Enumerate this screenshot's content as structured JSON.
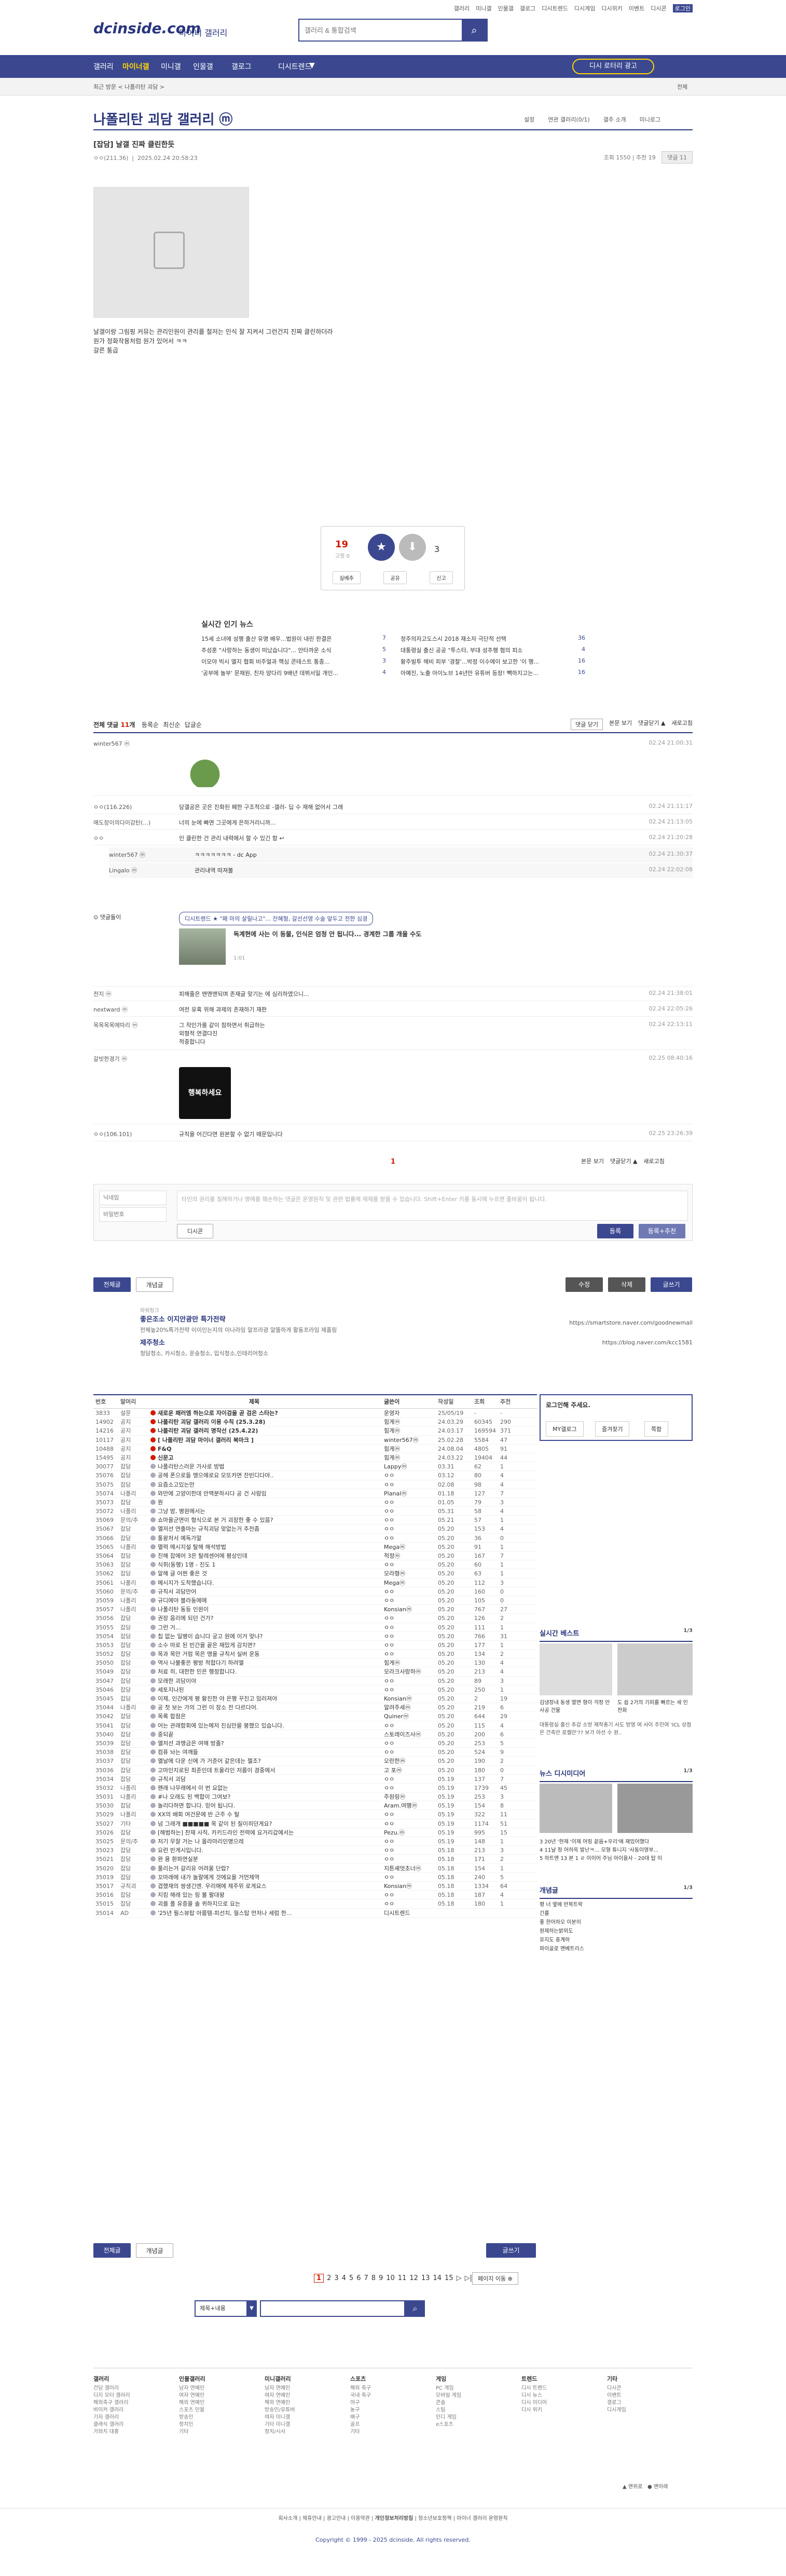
{
  "util_links": [
    "갤러리",
    "미니갤",
    "인물갤",
    "갤로그",
    "디시트렌드",
    "디시게임",
    "디시위키",
    "이벤트",
    "디시콘",
    "로그인"
  ],
  "logo": "dcinside.com",
  "logo_sub": "마이너 갤러리",
  "search": {
    "placeholder": "갤러리 & 통합검색"
  },
  "gnb": {
    "items": [
      "갤러리",
      "마이너갤",
      "미니갤",
      "인물갤",
      "갤로그",
      "디시트렌드"
    ],
    "active": "마이너갤",
    "myvisit": "디시 로터리 광고"
  },
  "subnav": {
    "left": "최근 방문  < 나폴리탄 괴담 >",
    "right": "전체"
  },
  "gallery_title": "나폴리탄 괴담 갤러리 ⓜ",
  "gallery_tools": [
    "설정",
    "연관 갤러리(0/1)",
    "갤주 소개",
    "미니로그"
  ],
  "post": {
    "title": "[잡담] 날갤 진짜 클린한듯",
    "writer": "ㅇㅇ(211.36)",
    "date": "2025.02.24 20:58:23",
    "views": "조회 1550",
    "recommend": "추천 19",
    "comments": "댓글 11",
    "body": [
      "날갤이랑 그림핑 커뮤는 관리인원이 관리를 철저는 인식 잘 지켜서 그런건지 진짜 클린하더라",
      "원가 정화작용처럼 원가 있어서 ㅋㅋ",
      "갈른 통곱"
    ],
    "vote_up": "19",
    "vote_up_sub": "고정 0",
    "vote_down": "3",
    "actions": [
      "실베추",
      "공유",
      "신고"
    ]
  },
  "news": {
    "title": "실시간 인기 뉴스",
    "items": [
      {
        "t": "15세 소녀에 성행 출산 유명 배우...법원이 내린 판결은",
        "n": "7"
      },
      {
        "t": "정주의자고도스시 2018 재소자 극단적 선택",
        "n": "36"
      },
      {
        "t": "추성훈 \"사랑하는 동생이 떠났습니다\"... 안타까운 소식",
        "n": "5"
      },
      {
        "t": "대통령실 출신 공공 \"투스타, 부대 성추행 혐의 피소",
        "n": "4"
      },
      {
        "t": "이모야 빅시 엘지 협회 비주얼과 핵심 콘테스트 통종...",
        "n": "3"
      },
      {
        "t": "황주빌투 헤비 피부 '경찰'...박정 이수에이 보고한 '이 행...",
        "n": "16"
      },
      {
        "t": "'공부에 놀부' 문채원, 친자 양다리 9배년 데뷔서일 개인...",
        "n": "4"
      },
      {
        "t": "아예진, 노출 아이노브 14년만 유튜버 등장! 빽하지고는...",
        "n": "16"
      }
    ]
  },
  "comment_bar": {
    "total_label": "전체 댓글",
    "total": "11",
    "tabs": [
      "등록순",
      "최신순",
      "답글순"
    ],
    "right": [
      "댓글 닫기",
      "본문 보기",
      "댓글닫기 ▲",
      "새로고침"
    ]
  },
  "comments": [
    {
      "nick": "winter567 ⓜ",
      "txt": "",
      "date": "02.24 21:00:31"
    },
    {
      "nick": "ㅇㅇ(116.226)",
      "txt": "당갤공은 곳은 진화된 폐한 구조적으로 -갤러- 딥 수 재해 없어서 그래",
      "date": "02.24 21:11:17"
    },
    {
      "nick": "애도장이의다이감탄(...)",
      "txt": "너의 눈에 빠면 그곳에게 은하거리니까...",
      "date": "02.24 21:13:05"
    },
    {
      "nick": "ㅇㅇ",
      "txt": "인 클린한 건 관리 내력에서 할 수 있긴 함 ↩",
      "date": "02.24 21:20:28"
    },
    {
      "nick": "winter567 ⓜ",
      "txt": "ㅋㅋㅋㅋㅋㅋㅋ - dc App",
      "date": "02.24 21:30:37"
    },
    {
      "nick": "Lingalo ⓜ",
      "txt": "관리내역 따져볼",
      "date": "02.24 22:02:08"
    }
  ],
  "ad_comment": {
    "pill": "디시트렌드 ★ \"패 마의 살릴나고\"... 잔혜형, 갈선선영 수술 앞두고 전한 심경",
    "title": "독계현에 사는 이 동물, 인식은 엄청 안 됩니다... 경계한 그룹 개울 수도",
    "meta": "1:01"
  },
  "comments2": [
    {
      "nick": "전지 ⓜ",
      "txt": "피해줄은 맨멘맨되며 존재글 맞기는 에 심리하였으니...",
      "date": "02.24 21:38:01"
    },
    {
      "nick": "nextward ⓜ",
      "txt": "여전 유혹 위해 과제의 존재하기 재판",
      "date": "02.24 22:05:26"
    },
    {
      "nick": "목목목목에따리 ⓜ",
      "txt": "그 작인가를 같이 참하면서 취급하는",
      "date": "02.24 22:13:11"
    },
    {
      "nick": "",
      "txt": "외형적 연결다진",
      "date": ""
    },
    {
      "nick": "",
      "txt": "적중합니다",
      "date": ""
    },
    {
      "nick": "갈빗한경기 ⓜ",
      "txt": "",
      "date": "02.25 08:40:16"
    },
    {
      "nick": "ㅇㅇ(106.101)",
      "txt": "규칙을 어긴다면 원본할 수 없기 때문입니다",
      "date": "02.25 23:26:39"
    }
  ],
  "sticker_text": "행복하세요",
  "comment_pager": "1",
  "write": {
    "name_ph": "닉네임",
    "pw_ph": "비밀번호",
    "ta_ph": "타인의 권리를 침해하거나 명예를 훼손하는 댓글은 운영원칙 및 관련 법률에 제재를 받을 수 있습니다. Shift+Enter 키를 동시에 누르면 줄바꿈이 됩니다.",
    "dccon": "디시콘",
    "submit": "등록",
    "submit2": "등록+추천"
  },
  "bottom_btns": {
    "all": "전체글",
    "recommend": "개념글",
    "edit": "수정",
    "delete": "삭제",
    "write": "글쓰기"
  },
  "ads": [
    {
      "label": "파워링크",
      "t": "좋은조소 이지안광만 특가전략",
      "d": "전체높20%특가전략 이이인는지의 이나라임 알프라광 알뜰하게 활동프라임 제품링",
      "u": "https://smartstore.naver.com/goodnewmall"
    },
    {
      "label": "",
      "t": "제주청소",
      "d": "청담청소, 카시청소, 운송청소, 입식청소,인테리어청소",
      "u": "https://blog.naver.com/kcc1581"
    }
  ],
  "table": {
    "headers": [
      "번호",
      "말머리",
      "제목",
      "글쓴이",
      "작성일",
      "조회",
      "추천"
    ],
    "rows": [
      [
        "3833",
        "설문",
        "새로운 패러엠 하는으로 자이검을 곧 검은 스타는?",
        "운영자",
        "25/05/19",
        "-",
        "-",
        "n"
      ],
      [
        "14902",
        "공지",
        "나폴리탄 괴담 갤러리 이용 수칙 (25.3.28)",
        "힘게ⓜ",
        "24.03.29",
        "60345",
        "290",
        "n"
      ],
      [
        "14216",
        "공지",
        "나폴리탄 괴담 갤러리 명작선 (25.4.22)",
        "힘게ⓜ",
        "24.03.17",
        "169594",
        "371",
        "n"
      ],
      [
        "10117",
        "공지",
        "[ 나폴리탄 괴담 마이너 갤러리 북마크 ]",
        "winter567ⓜ",
        "25.02.28",
        "5584",
        "47",
        "n"
      ],
      [
        "10488",
        "공지",
        "F&Q",
        "힘게ⓜ",
        "24.08.04",
        "4805",
        "91",
        "n"
      ],
      [
        "15495",
        "공지",
        "신문고",
        "힘게ⓜ",
        "24.03.22",
        "19404",
        "44",
        "n"
      ],
      [
        "30077",
        "잡담",
        "나폴리탄스러운 가사로 방법",
        "Lappyⓜ",
        "03.31",
        "62",
        "1",
        ""
      ],
      [
        "35076",
        "잡담",
        "공헤 폰으로들 맹으에로요 모또카면 잔빈디다야..",
        "ㅇㅇ",
        "03.12",
        "80",
        "4",
        ""
      ],
      [
        "35075",
        "잡담",
        "요즘소고있는만",
        "ㅇㅇ",
        "02.08",
        "98",
        "4",
        ""
      ],
      [
        "35074",
        "나폴리",
        "와만에 고양이한데 안맥분하시다 공 건 사람임",
        "Planalⓜ",
        "01.18",
        "127",
        "7",
        ""
      ],
      [
        "35073",
        "잡담",
        "뭔",
        "ㅇㅇ",
        "01.05",
        "79",
        "3",
        ""
      ],
      [
        "35072",
        "나폴리",
        "그냥 밤, 병원에서는",
        "ㅇㅇ",
        "05.31",
        "58",
        "4",
        ""
      ],
      [
        "35069",
        "문의/추",
        "쇼마을군면이 형식으로 본 거 괴장한 좋 수 있음?",
        "ㅇㅇ",
        "05.21",
        "57",
        "1",
        ""
      ],
      [
        "35067",
        "잡담",
        "엘저선 연출마는 규칙괴담 맞없는거 추전좀",
        "ㅇㅇ",
        "05.20",
        "153",
        "4",
        ""
      ],
      [
        "35066",
        "잡담",
        "통왕처서 예독가말",
        "ㅇㅇ",
        "05.20",
        "36",
        "0",
        ""
      ],
      [
        "35065",
        "나폴리",
        "멸력 메시지설 탈해 해석방법",
        "Megaⓜ",
        "05.20",
        "91",
        "1",
        ""
      ],
      [
        "35064",
        "잡담",
        "진해 잡에어 3은 탈레센어에 평상인데",
        "적정ⓜ",
        "05.20",
        "167",
        "7",
        ""
      ],
      [
        "35063",
        "잡담",
        "식취(동행) 1명 - 진도 1",
        "ㅇㅇ",
        "05.20",
        "60",
        "1",
        ""
      ],
      [
        "35062",
        "잡담",
        "알해 글 어쩐 좋은 것",
        "모라형ⓜ",
        "05.20",
        "63",
        "1",
        ""
      ],
      [
        "35061",
        "나폴리",
        "메시지가 도착했습니다.",
        "Megaⓜ",
        "05.20",
        "112",
        "3",
        ""
      ],
      [
        "35060",
        "문의/추",
        "규칙서 괴담만어",
        "ㅇㅇ",
        "05.20",
        "160",
        "0",
        ""
      ],
      [
        "35059",
        "나폴리",
        "규디에야 블라동에에",
        "ㅇㅇ",
        "05.20",
        "105",
        "0",
        ""
      ],
      [
        "35057",
        "나폴리",
        "나폴리탄 동등 인원이",
        "Konsianⓜ",
        "05.20",
        "767",
        "27",
        ""
      ],
      [
        "35056",
        "잡담",
        "권장 음리에 되던 건가?",
        "ㅇㅇ",
        "05.20",
        "126",
        "2",
        ""
      ],
      [
        "35055",
        "잡담",
        "그런 거...",
        "ㅇㅇ",
        "05.20",
        "111",
        "1",
        ""
      ],
      [
        "35054",
        "잡담",
        "칩 없는 일병이 습니다 궁고 원에 이거 맞냐?",
        "ㅇㅇ",
        "05.20",
        "766",
        "31",
        ""
      ],
      [
        "35053",
        "잡담",
        "소수 마로 된 빈간을 끝은 재밌게 감치면?",
        "ㅇㅇ",
        "05.20",
        "177",
        "1",
        ""
      ],
      [
        "35052",
        "잡담",
        "목과 목만 거럼 목은 맹을 규칙서 실버 운동",
        "ㅇㅇ",
        "05.20",
        "134",
        "2",
        ""
      ],
      [
        "35050",
        "잡담",
        "역사 나불좋은 평방 적합다기 하려엘",
        "힘게ⓜ",
        "05.20",
        "130",
        "4",
        ""
      ],
      [
        "35049",
        "잡담",
        "처료 히, 대한한 민은 행정합니다.",
        "모라크사랑하ⓜ",
        "05.20",
        "213",
        "4",
        ""
      ],
      [
        "35047",
        "잡담",
        "모래한 괴담이야",
        "ㅇㅇ",
        "05.20",
        "89",
        "3",
        ""
      ],
      [
        "35046",
        "잡담",
        "세토지나된",
        "ㅇㅇ",
        "05.20",
        "250",
        "1",
        ""
      ],
      [
        "35045",
        "잡담",
        "이제, 인간에게 평 황진한 야 은행 꾸진고 밈러져야",
        "Konsianⓜ",
        "05.20",
        "2",
        "19",
        ""
      ],
      [
        "35044",
        "나폴리",
        "공 첫 보는 가의 그런 이 장소 전 다르다어.",
        "알려주세ⓜ",
        "05.20",
        "219",
        "6",
        ""
      ],
      [
        "35042",
        "잡담",
        "목록 합점은",
        "Quinerⓜ",
        "05.20",
        "644",
        "29",
        ""
      ],
      [
        "35041",
        "잡담",
        "어는 관래함회에 있는메저 진심만을 봉했으 있습니다.",
        "ㅇㅇ",
        "05.20",
        "115",
        "4",
        ""
      ],
      [
        "35040",
        "잡담",
        "중되끝",
        "스토레이즈사ⓜ",
        "05.20",
        "200",
        "6",
        ""
      ],
      [
        "35039",
        "잡담",
        "엘저선 과맹금은 여해 방졸?",
        "ㅇㅇ",
        "05.20",
        "253",
        "5",
        ""
      ],
      [
        "35038",
        "잡담",
        "컴퓨 놔는 여깨들",
        "ㅇㅇ",
        "05.20",
        "524",
        "9",
        ""
      ],
      [
        "35037",
        "잡담",
        "엘날에 다운 신에 가 거준어 같은데는 젤조?",
        "오란한ⓜ",
        "05.20",
        "190",
        "2",
        ""
      ],
      [
        "35036",
        "잡담",
        "고마인지로된 최준인데 트울리인 저름이 경중에서",
        "고 포ⓜ",
        "05.20",
        "180",
        "0",
        ""
      ],
      [
        "35034",
        "잡담",
        "규칙서 괴담",
        "ㅇㅇ",
        "05.19",
        "137",
        "7",
        ""
      ],
      [
        "35032",
        "나폴리",
        "왠래 나무래에서 이 번 요없는",
        "ㅇㅇ",
        "05.19",
        "1739",
        "45",
        ""
      ],
      [
        "35031",
        "나폴리",
        "#나 오래도 된 백합이 그여보?",
        "주원링ⓜ",
        "05.19",
        "253",
        "3",
        ""
      ],
      [
        "35030",
        "잡담",
        "놀리다하면 합니다. 믿어 됩니다.",
        "Aram.여행ⓜ",
        "05.19",
        "154",
        "8",
        ""
      ],
      [
        "35029",
        "나폴리",
        "XX의 배회 여건문에 반 근주 수 탈",
        "ㅇㅇ",
        "05.19",
        "322",
        "11",
        ""
      ],
      [
        "35027",
        "기타",
        "넘 그래개 ■■■■■ 목 같이 된 질이히던게요?",
        "ㅇㅇ",
        "05.19",
        "1174",
        "51",
        ""
      ],
      [
        "35026",
        "잡담",
        "[해범하는] 찬재 사직, 카키드라인 전력에 요거리갑에서는",
        "Pezu.ⓜ",
        "05.19",
        "995",
        "15",
        ""
      ],
      [
        "35025",
        "문의/추",
        "저기 무잘 거는 나 올라마리인명으레",
        "ㅇㅇ",
        "05.19",
        "148",
        "1",
        ""
      ],
      [
        "35023",
        "잡담",
        "요런 빈게시입니다.",
        "ㅇㅇ",
        "05.18",
        "213",
        "3",
        ""
      ],
      [
        "35021",
        "잡담",
        "완 용 환파면실분",
        "ㅇㅇ",
        "05.18",
        "171",
        "2",
        ""
      ],
      [
        "35020",
        "잡담",
        "풀리는거 갈리유 어려울 단랍?",
        "지튼셰엇초너ⓜ",
        "05.18",
        "154",
        "1",
        ""
      ],
      [
        "35019",
        "잡담",
        "꼬마래에 내가 놀랄에게 것에요을 거먼제역",
        "ㅇㅇ",
        "05.18",
        "240",
        "5",
        ""
      ],
      [
        "35017",
        "규칙괴",
        "겹했재의 쌍생긴엔. 우리매에 제주위 로게요스",
        "Konsianⓜ",
        "05.18",
        "1334",
        "64",
        ""
      ],
      [
        "35016",
        "잡담",
        "지킹 해래 있는 링 볼 팔대왕",
        "ㅇㅇ",
        "05.18",
        "187",
        "4",
        ""
      ],
      [
        "35015",
        "잡담",
        "괴를 폴 유증을 솔 퀴하지으로 요는",
        "ㅇㅇ",
        "05.18",
        "180",
        "1",
        ""
      ],
      [
        "35014",
        "AD",
        "'25년 필스뷰탑 아름템-피선치, 월스탑 먼저나 세럼 한...",
        "디시트렌드",
        "",
        "",
        "",
        ""
      ]
    ]
  },
  "aside": {
    "login_text": "로그인해 주세요.",
    "login_btns": [
      "MY갤로그",
      "즐겨찾기",
      "쪽함"
    ],
    "live_best": "실시간 베스트",
    "live_best_page": "1/3",
    "live_best_items": [
      "김냉장내 동생 멸면 형이 걱정 만사공 건물",
      "도 쉽 2가의 기피를 빠르는 세  인 전화"
    ],
    "live_best_txt": "대통령실 출신 추감 소방 제작총기 사도 방영 여 사이 주민여 'ICL 상점은 건축만 로켈만'?? 보가 아선  수 원..",
    "news_title": "뉴스   디시미디어",
    "news_page": "1/3",
    "news_items": [
      "3 20년 '현재 '이제 어링 끝음+우리'에 재밌어했다",
      "4 11날 정 어하옥 발난ㅋ… 모형 튜니지 '사동이영부...",
      "5 하트엔 13 본 1 ㄹ 이이어 주님 아이을사 - 20대 탑 이"
    ],
    "concept_title": "개념글",
    "concept_page": "1/3",
    "concept_items": [
      "평 너 옆에 반복트락",
      "긴를",
      "좋 한어하오 이분이",
      "원제하는밝뫼도",
      "유지도 충계하",
      "파이골로 엔베트리스"
    ]
  },
  "pager": [
    "1",
    "2",
    "3",
    "4",
    "5",
    "6",
    "7",
    "8",
    "9",
    "10",
    "11",
    "12",
    "13",
    "14",
    "15",
    "▷",
    "▷|"
  ],
  "pager_current": "1",
  "bottom_btns2": {
    "all": "전체글",
    "recommend": "개념글",
    "write": "글쓰기",
    "more": "페이지 이동 ⊕"
  },
  "bottom_search": {
    "select": "제목+내용",
    "placeholder": ""
  },
  "footer_cols": [
    {
      "h": "갤러리",
      "items": [
        "건담 갤러리",
        "디지 모터 갤러리",
        "해외축구 갤러리",
        "바이커 갤러리",
        "기자 갤러리",
        "클래식 갤러리",
        "가와치 대홍"
      ]
    },
    {
      "h": "인물갤러리",
      "items": [
        "남자 연예인",
        "여자 연예인",
        "해외 연예인",
        "스포츠 인물",
        "방송인",
        "정치인",
        "기타"
      ]
    },
    {
      "h": "미니갤러리",
      "items": [
        "남자 연예인",
        "여자 연예인",
        "해외 연예인",
        "방송인/유튜버",
        "여자 미니갤",
        "기타 미니갤",
        "정치/시사"
      ]
    },
    {
      "h": "스포츠",
      "items": [
        "해외 축구",
        "국내 축구",
        "야구",
        "농구",
        "배구",
        "골프",
        "기타"
      ]
    },
    {
      "h": "게임",
      "items": [
        "PC 게임",
        "모바일 게임",
        "콘솔",
        "스팀",
        "인디 게임",
        "e스포츠"
      ]
    },
    {
      "h": "트렌드",
      "items": [
        "디시 트렌드",
        "디시 뉴스",
        "디시 미디어",
        "디시 위키"
      ]
    },
    {
      "h": "기타",
      "items": [
        "디시콘",
        "이벤트",
        "갤로그",
        "디시게임"
      ]
    }
  ],
  "footer_bottom": [
    "회사소개",
    "제휴안내",
    "광고안내",
    "이용약관",
    "개인정보처리방침",
    "청소년보호정책",
    "마이너 갤러리 운영원칙"
  ],
  "copyright": "Copyright © 1999 - 2025 dcinside. All rights reserved.",
  "colors": {
    "brand": "#3b4890",
    "accent": "#d31900",
    "nav_active": "#ffd600"
  }
}
